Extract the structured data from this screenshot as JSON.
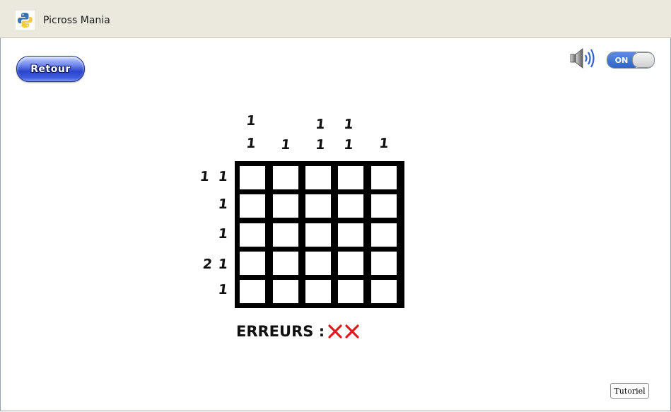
{
  "window": {
    "title": "Picross Mania",
    "icon": "python-icon"
  },
  "back_button": {
    "label": "Retour"
  },
  "sound": {
    "icon": "speaker-icon",
    "toggle_label": "ON",
    "state": "on"
  },
  "puzzle": {
    "size": [
      5,
      5
    ],
    "column_clues": [
      [
        "1",
        "1"
      ],
      [
        "1"
      ],
      [
        "1",
        "1"
      ],
      [
        "1",
        "1"
      ],
      [
        "1"
      ]
    ],
    "row_clues": [
      [
        "1",
        "1"
      ],
      [
        "1"
      ],
      [
        "1"
      ],
      [
        "2",
        "1"
      ],
      [
        "1"
      ]
    ]
  },
  "errors": {
    "label": "ERREURS :",
    "count": 2,
    "mark_icon": "red-x-icon",
    "mark_color": "#e01b1b"
  },
  "tutorial_button": {
    "label": "Tutoriel"
  }
}
